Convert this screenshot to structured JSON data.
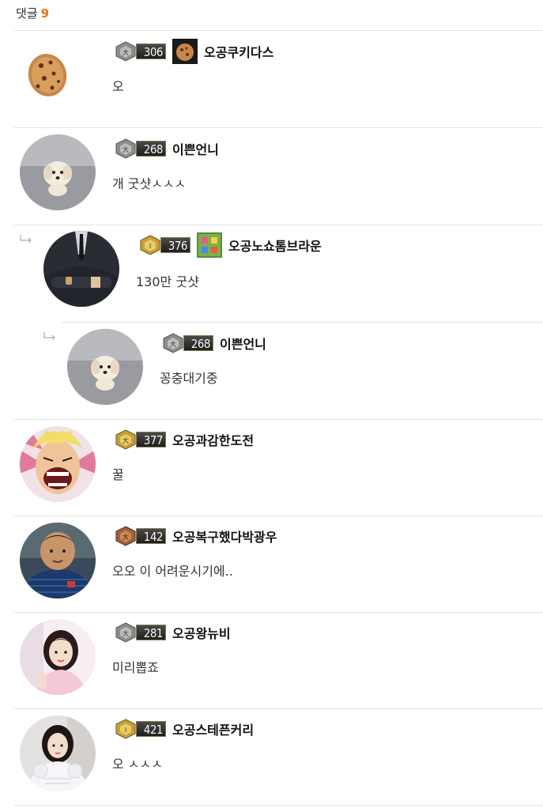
{
  "header": {
    "label": "댓글",
    "count": "9"
  },
  "comments": [
    {
      "level": "306",
      "nickname": "오공쿠키다스",
      "text": "오",
      "avatar": "cookie-avatar",
      "badge": "silver",
      "has_user_icon": true
    },
    {
      "level": "268",
      "nickname": "이쁜언니",
      "text": "개 굿샷ㅅㅅㅅ",
      "avatar": "puppy-avatar",
      "badge": "silver",
      "has_user_icon": false
    },
    {
      "level": "376",
      "nickname": "오공노쇼톰브라운",
      "text": "130만 굿샷",
      "avatar": "suit-avatar",
      "badge": "gold",
      "has_user_icon": true
    },
    {
      "level": "268",
      "nickname": "이쁜언니",
      "text": "꽁충대기중",
      "avatar": "puppy-avatar",
      "badge": "silver",
      "has_user_icon": false
    },
    {
      "level": "377",
      "nickname": "오공과감한도전",
      "text": "꿀",
      "avatar": "anime-avatar",
      "badge": "gold",
      "has_user_icon": false
    },
    {
      "level": "142",
      "nickname": "오공복구했다박광우",
      "text": "오오 이 어려운시기에..",
      "avatar": "man-avatar",
      "badge": "bronze",
      "has_user_icon": false
    },
    {
      "level": "281",
      "nickname": "오공왕뉴비",
      "text": "미리뽑죠",
      "avatar": "girl-avatar",
      "badge": "silver",
      "has_user_icon": false
    },
    {
      "level": "421",
      "nickname": "오공스테픈커리",
      "text": "오 ㅅㅅㅅ",
      "avatar": "woman-avatar",
      "badge": "gold",
      "has_user_icon": false
    }
  ],
  "colors": {
    "count": "#e8731b",
    "divider": "#e3e3e3",
    "silver": "#8c8c8c",
    "gold": "#c8a038",
    "bronze": "#a0603a"
  }
}
